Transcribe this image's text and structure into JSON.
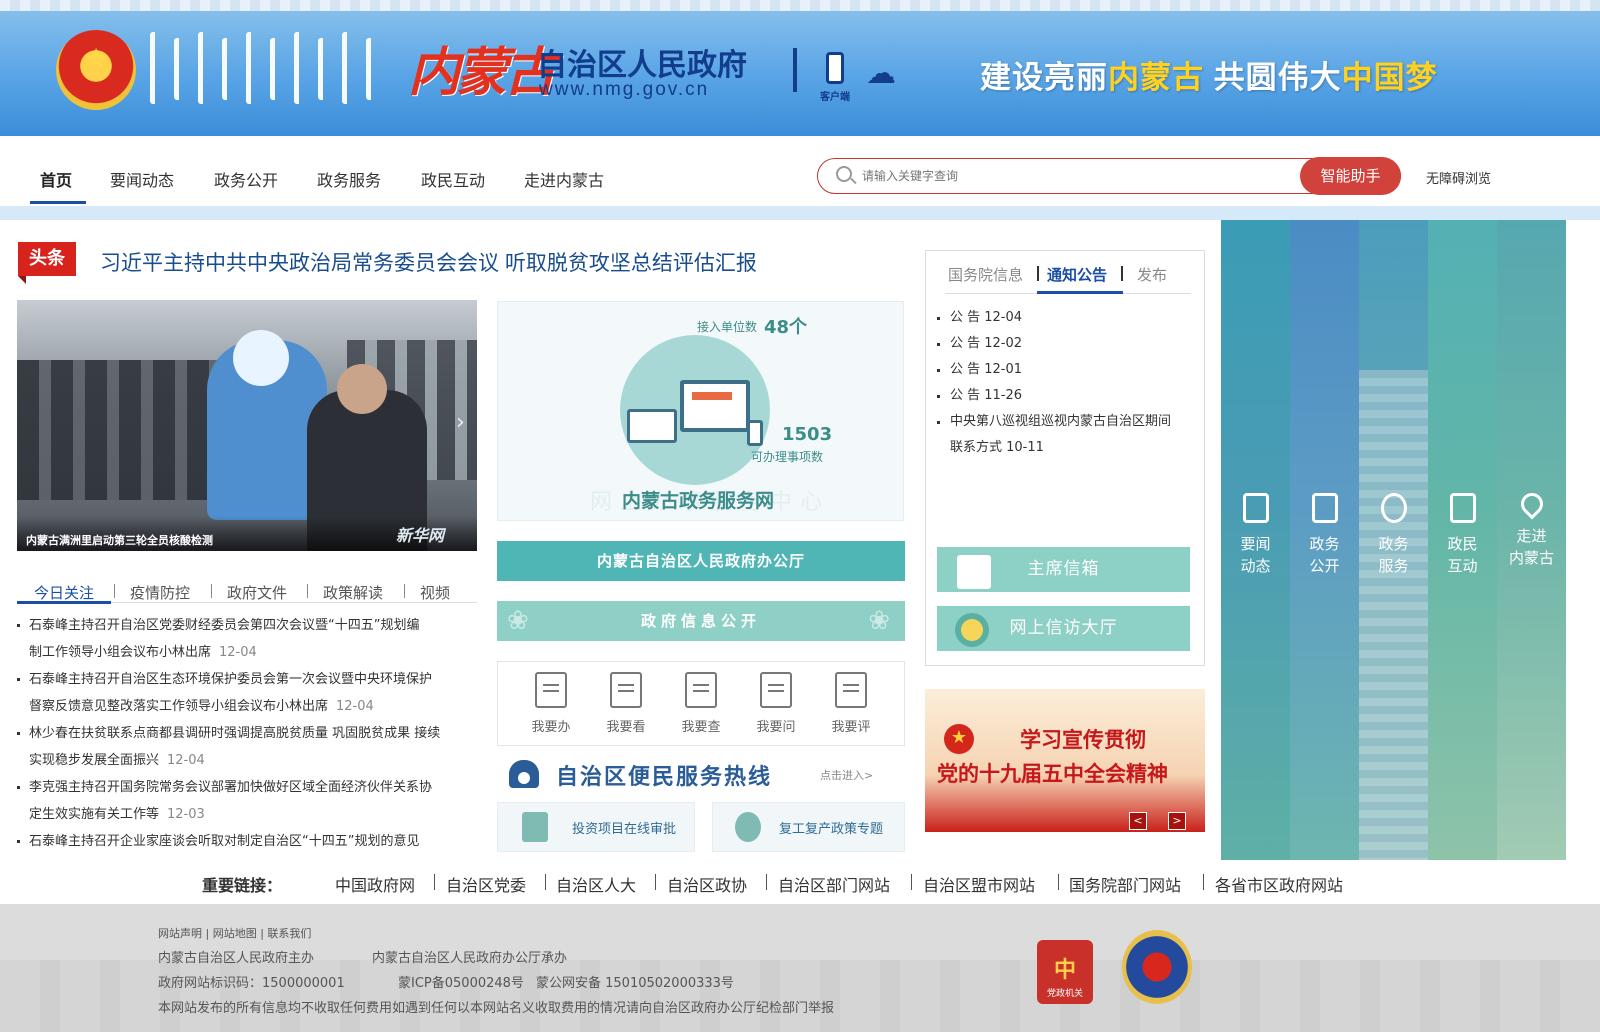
{
  "header": {
    "site_name_calligraphy": "内蒙古",
    "site_name": "自治区人民政府",
    "site_url": "www.nmg.gov.cn",
    "client_label": "客户端",
    "slogan_part1": "建设亮丽",
    "slogan_part2": "内蒙古",
    "slogan_part3": " 共圆伟大",
    "slogan_part4": "中国梦"
  },
  "nav": {
    "items": [
      {
        "label": "首页"
      },
      {
        "label": "要闻动态"
      },
      {
        "label": "政务公开"
      },
      {
        "label": "政务服务"
      },
      {
        "label": "政民互动"
      },
      {
        "label": "走进内蒙古"
      }
    ],
    "search_placeholder": "请输入关键字查询",
    "assistant_button": "智能助手",
    "accessibility": "无障碍浏览"
  },
  "headline": {
    "tag": "头条",
    "title": "习近平主持中共中央政治局常务委员会会议 听取脱贫攻坚总结评估汇报"
  },
  "photo": {
    "caption": "内蒙古满洲里启动第三轮全员核酸检测",
    "logo": "新华网"
  },
  "left_tabs": [
    "今日关注",
    "疫情防控",
    "政府文件",
    "政策解读",
    "视频"
  ],
  "news": [
    {
      "line1": "石泰峰主持召开自治区党委财经委员会第四次会议暨“十四五”规划编",
      "line2": "制工作领导小组会议布小林出席",
      "date": "12-04"
    },
    {
      "line1": "石泰峰主持召开自治区生态环境保护委员会第一次会议暨中央环境保护",
      "line2": "督察反馈意见整改落实工作领导小组会议布小林出席",
      "date": "12-04"
    },
    {
      "line1": "林少春在扶贫联系点商都县调研时强调提高脱贫质量 巩固脱贫成果 接续",
      "line2": "实现稳步发展全面振兴",
      "date": "12-04"
    },
    {
      "line1": "李克强主持召开国务院常务会议部署加快做好区域全面经济伙伴关系协",
      "line2": "定生效实施有关工作等",
      "date": "12-03"
    },
    {
      "line1": "石泰峰主持召开企业家座谈会听取对制定自治区“十四五”规划的意见",
      "line2": "",
      "date": ""
    }
  ],
  "service": {
    "units_label": "接入单位数",
    "units_value": "48个",
    "items_value": "1503",
    "items_label": "可办理事项数",
    "title": "内蒙古政务服务网",
    "watermark": "网上办事服务中心"
  },
  "bars": {
    "office": "内蒙古自治区人民政府办公厅",
    "info_public": "政府信息公开"
  },
  "quick_actions": [
    {
      "label": "我要办"
    },
    {
      "label": "我要看"
    },
    {
      "label": "我要查"
    },
    {
      "label": "我要问"
    },
    {
      "label": "我要评"
    }
  ],
  "hotline": {
    "title": "自治区便民服务热线",
    "more": "点击进入>"
  },
  "sub_buttons": [
    {
      "label": "投资项目在线审批"
    },
    {
      "label": "复工复产政策专题"
    }
  ],
  "right_tabs": [
    "国务院信息",
    "通知公告",
    "发布"
  ],
  "notices": [
    {
      "text": "公 告  12-04"
    },
    {
      "text": "公 告  12-02"
    },
    {
      "text": "公 告  12-01"
    },
    {
      "text": "公 告  11-26"
    },
    {
      "text": "中央第八巡视组巡视内蒙古自治区期间"
    },
    {
      "text": "联系方式  10-11"
    }
  ],
  "right_buttons": {
    "mailbox": "主席信箱",
    "petition": "网上信访大厅"
  },
  "promo": {
    "line1": "学习宣传贯彻",
    "line2": "党的十九届五中全会精神",
    "prev": "<",
    "next": ">"
  },
  "columns": [
    {
      "line1": "要闻",
      "line2": "动态"
    },
    {
      "line1": "政务",
      "line2": "公开"
    },
    {
      "line1": "政务",
      "line2": "服务"
    },
    {
      "line1": "政民",
      "line2": "互动"
    },
    {
      "line1": "走进",
      "line2": "内蒙古"
    }
  ],
  "links": {
    "label": "重要链接：",
    "items": [
      "中国政府网",
      "自治区党委",
      "自治区人大",
      "自治区政协",
      "自治区部门网站",
      "自治区盟市网站",
      "国务院部门网站",
      "各省市区政府网站"
    ]
  },
  "footer": {
    "top_links": "网站声明 | 网站地图 | 联系我们",
    "host": "内蒙古自治区人民政府主办",
    "organizer": "内蒙古自治区人民政府办公厅承办",
    "site_id": "政府网站标识码：1500000001",
    "icp": "蒙ICP备05000248号",
    "police": "蒙公网安备 15010502000333号",
    "notice": "本网站发布的所有信息均不收取任何费用如遇到任何以本网站名义收取费用的情况请向自治区政府办公厅纪检部门举报",
    "badge_label": "党政机关"
  },
  "colors": {
    "primary_blue": "#1b4ea6",
    "teal": "#4fb5b5",
    "red": "#d2423c"
  }
}
